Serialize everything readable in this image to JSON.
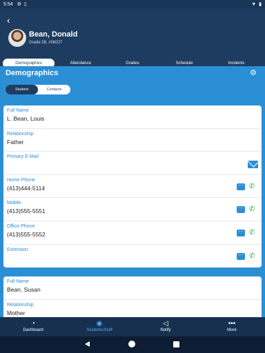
{
  "status_bar": {
    "time": "5:54"
  },
  "header": {
    "student_name": "Bean, Donald",
    "student_sub": "Grade 08, #08027"
  },
  "tabs": [
    "Demographics",
    "Attendance",
    "Grades",
    "Schedule",
    "Incidents"
  ],
  "main": {
    "title": "Demographics",
    "segments": [
      "Student",
      "Contacts"
    ]
  },
  "contact1": {
    "full_name_label": "Full Name",
    "full_name": "L. Bean, Louis",
    "relationship_label": "Relationship",
    "relationship": "Father",
    "email_label": "Primary E-Mail",
    "email": "",
    "home_label": "Home Phone",
    "home": "(413)444-5114",
    "mobile_label": "Mobile",
    "mobile": "(413)555-5551",
    "office_label": "Office Phone",
    "office": "(413)555-5552",
    "ext_label": "Extension",
    "ext": ""
  },
  "contact2": {
    "full_name_label": "Full Name",
    "full_name": "Bean, Susan",
    "relationship_label": "Relationship",
    "relationship": "Mother"
  },
  "bottom_nav": [
    "Dashboard",
    "Students/Staff",
    "Notify",
    "More"
  ],
  "colors": {
    "header": "#1d3c5f",
    "accent": "#2b8fd6",
    "phone": "#2aa84a",
    "active_nav": "#4db0ff"
  }
}
